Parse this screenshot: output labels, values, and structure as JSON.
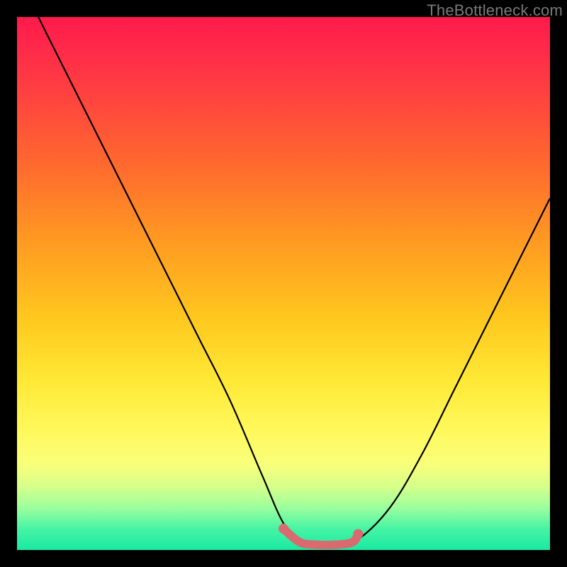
{
  "watermark": "TheBottleneck.com",
  "chart_data": {
    "type": "line",
    "title": "",
    "xlabel": "",
    "ylabel": "",
    "xlim": [
      0,
      100
    ],
    "ylim": [
      0,
      100
    ],
    "grid": false,
    "legend": false,
    "series": [
      {
        "name": "bottleneck-curve",
        "color": "#000000",
        "x": [
          4,
          10,
          16,
          22,
          28,
          34,
          40,
          46,
          50,
          53,
          56,
          60,
          64,
          70,
          76,
          82,
          88,
          94,
          100
        ],
        "y": [
          100,
          88,
          76,
          64,
          52,
          40,
          28,
          14,
          5,
          2,
          1,
          1,
          2,
          8,
          18,
          30,
          42,
          54,
          66
        ]
      },
      {
        "name": "optimal-range",
        "color": "#d96a6f",
        "x": [
          50,
          53,
          56,
          60,
          63,
          64
        ],
        "y": [
          4,
          1.5,
          1,
          1,
          1.5,
          3
        ]
      }
    ],
    "markers": [
      {
        "name": "optimal-start-dot",
        "x": 50,
        "y": 4,
        "color": "#d96a6f"
      },
      {
        "name": "optimal-end-dot",
        "x": 64,
        "y": 3,
        "color": "#d96a6f"
      }
    ]
  }
}
